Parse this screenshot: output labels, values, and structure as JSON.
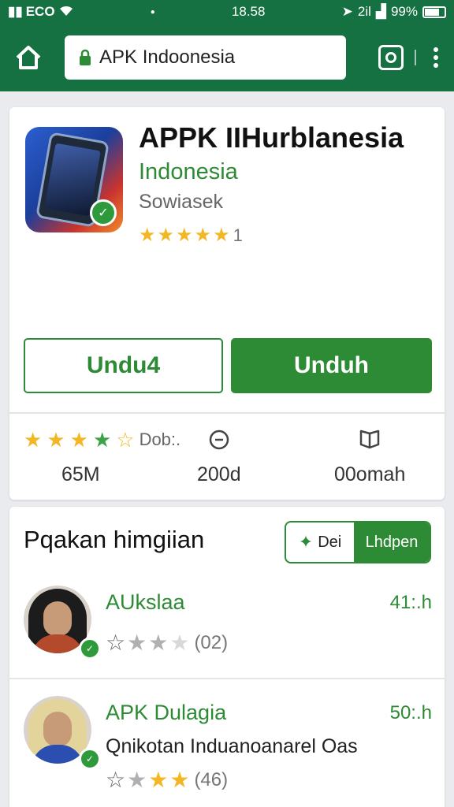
{
  "status_bar": {
    "carrier": "ECO",
    "time": "18.58",
    "network": "2il",
    "battery": "99%"
  },
  "browser": {
    "url": "APK Indoonesia"
  },
  "app": {
    "title": "APPK IIHurblanesia",
    "subtitle": "Indonesia",
    "developer": "Sowiasek",
    "rating_count": "1",
    "btn_outline": "Undu4",
    "btn_primary": "Unduh",
    "stats": [
      {
        "label": "Dob:.",
        "value": "65M"
      },
      {
        "value": "200d"
      },
      {
        "value": "00omah"
      }
    ]
  },
  "reviews": {
    "title": "Pqakan himgiian",
    "button_left": "Dei",
    "button_right": "Lhdpen",
    "items": [
      {
        "name": "AUkslaa",
        "time": "41:.h",
        "text": "",
        "count": "(02)",
        "stars": [
          0,
          0.6,
          0.6,
          0.3,
          0
        ]
      },
      {
        "name": "APK Dulagia",
        "time": "50:.h",
        "text": "Qnikotan Induanoanarel Oas",
        "count": "(46)",
        "stars": [
          0,
          0.6,
          1,
          1,
          0
        ]
      }
    ]
  },
  "colors": {
    "brand_green": "#157042",
    "accent_green": "#2e8b35",
    "star": "#f3b724"
  }
}
